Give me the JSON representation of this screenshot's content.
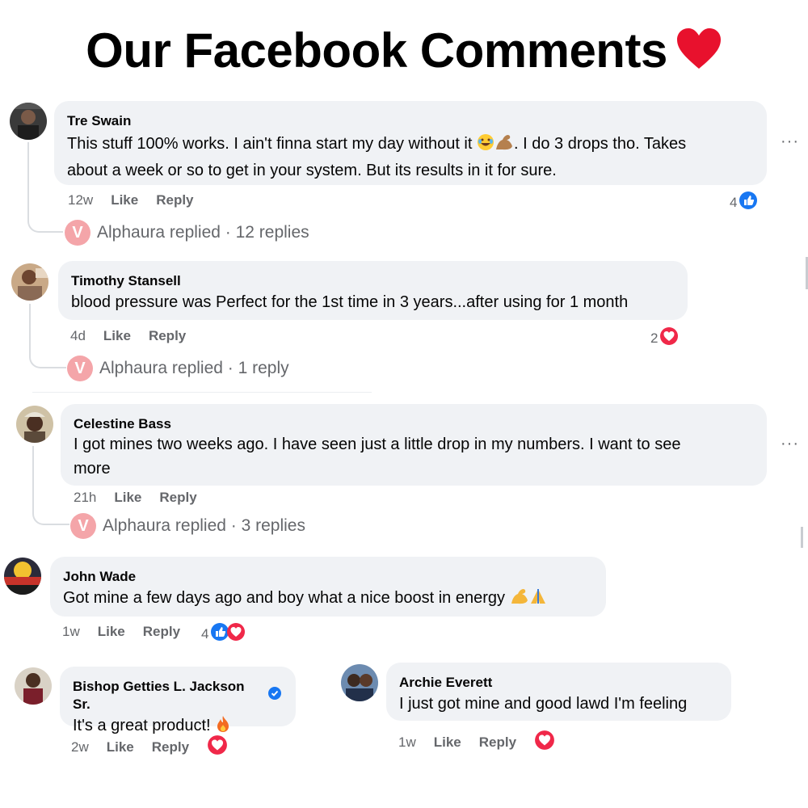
{
  "header": {
    "title": "Our Facebook Comments"
  },
  "reply_badge_letter": "V",
  "comments": [
    {
      "name": "Tre Swain",
      "text_a": "This stuff 100% works. I ain't finna start my day without it ",
      "text_b": ". I do 3 drops tho. Takes",
      "text_c": "about a week or so to get in your system. But its results in it for sure.",
      "time": "12w",
      "like": "Like",
      "reply": "Reply",
      "reactions": "4",
      "replied": "Alphaura replied · 12 replies",
      "more": "···"
    },
    {
      "name": "Timothy Stansell",
      "text": "blood pressure was Perfect for the 1st time in 3 years...after using for 1 month",
      "time": "4d",
      "like": "Like",
      "reply": "Reply",
      "reactions": "2",
      "replied": "Alphaura replied · 1 reply"
    },
    {
      "name": "Celestine Bass",
      "text_a": "I got mines two weeks ago. I have seen just a little drop in my numbers. I want to see",
      "text_b": "more",
      "time": "21h",
      "like": "Like",
      "reply": "Reply",
      "replied": "Alphaura replied · 3 replies",
      "more": "···"
    },
    {
      "name": "John Wade",
      "text": "Got mine a few days ago and boy what a nice boost in energy ",
      "time": "1w",
      "like": "Like",
      "reply": "Reply",
      "reactions": "4"
    },
    {
      "name": "Bishop Getties L. Jackson Sr.",
      "text": "It's a great product! ",
      "time": "2w",
      "like": "Like",
      "reply": "Reply"
    },
    {
      "name": "Archie Everett",
      "text": "I just got mine and good lawd I'm feeling",
      "time": "1w",
      "like": "Like",
      "reply": "Reply"
    }
  ],
  "colors": {
    "like_blue": "#1877f2",
    "love_red": "#f02849",
    "heart": "#e8112d",
    "bubble": "#f0f2f5"
  }
}
